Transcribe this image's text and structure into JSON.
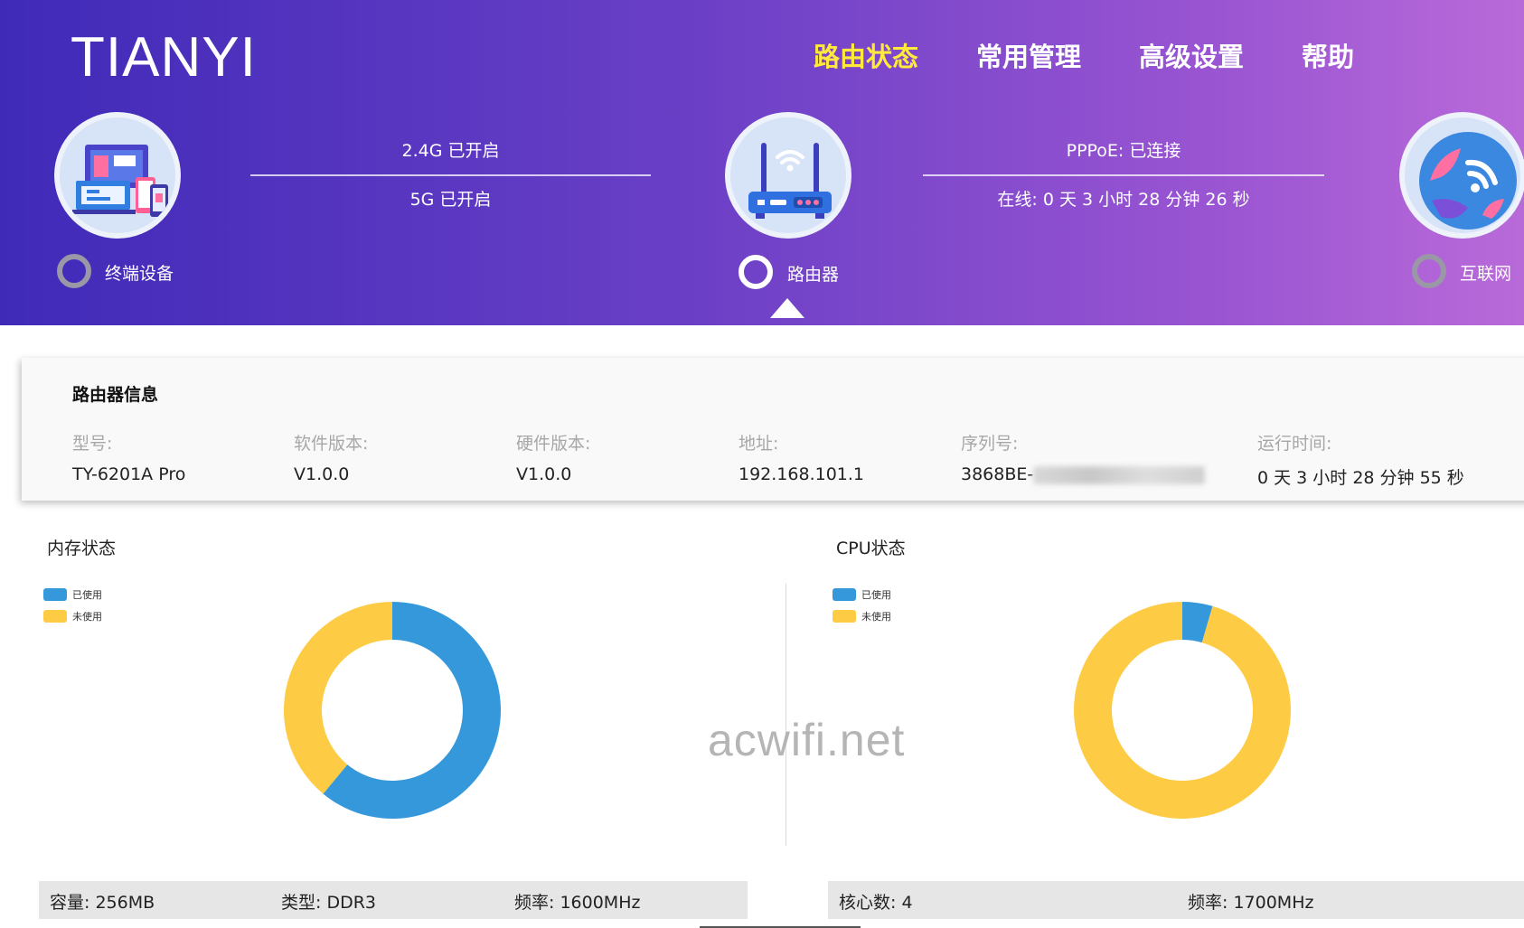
{
  "header": {
    "logo": "TIANYI",
    "nav": [
      {
        "label": "路由状态",
        "active": true
      },
      {
        "label": "常用管理",
        "active": false
      },
      {
        "label": "高级设置",
        "active": false
      },
      {
        "label": "帮助",
        "active": false
      }
    ],
    "nodes": {
      "terminal": {
        "label": "终端设备",
        "icon": "devices-icon"
      },
      "router": {
        "label": "路由器",
        "icon": "router-icon"
      },
      "internet": {
        "label": "互联网",
        "icon": "globe-icon"
      }
    },
    "wifi_link": {
      "top": "2.4G 已开启",
      "bottom": "5G 已开启"
    },
    "wan_link": {
      "top": "PPPoE: 已连接",
      "bottom": "在线: 0 天 3 小时 28 分钟 26 秒"
    }
  },
  "router_info": {
    "title": "路由器信息",
    "fields": [
      {
        "label": "型号:",
        "value": "TY-6201A Pro"
      },
      {
        "label": "软件版本:",
        "value": "V1.0.0"
      },
      {
        "label": "硬件版本:",
        "value": "V1.0.0"
      },
      {
        "label": "地址:",
        "value": "192.168.101.1"
      },
      {
        "label": "序列号:",
        "value": "3868BE-"
      },
      {
        "label": "运行时间:",
        "value": "0 天 3 小时 28 分钟 55 秒"
      }
    ]
  },
  "memory": {
    "title": "内存状态",
    "legend": [
      "已使用",
      "未使用"
    ],
    "stats": [
      "容量: 256MB",
      "类型: DDR3",
      "频率: 1600MHz"
    ]
  },
  "cpu": {
    "title": "CPU状态",
    "legend": [
      "已使用",
      "未使用"
    ],
    "stats": [
      "核心数: 4",
      "频率: 1700MHz"
    ]
  },
  "colors": {
    "used": "#3598db",
    "unused": "#fecb45",
    "nav_active": "#ffe93a"
  },
  "chart_data": [
    {
      "type": "pie",
      "categories": [
        "已使用",
        "未使用"
      ],
      "values": [
        61,
        39
      ]
    },
    {
      "type": "pie",
      "categories": [
        "已使用",
        "未使用"
      ],
      "values": [
        4.5,
        95.5
      ]
    }
  ],
  "watermark": "acwifi.net"
}
